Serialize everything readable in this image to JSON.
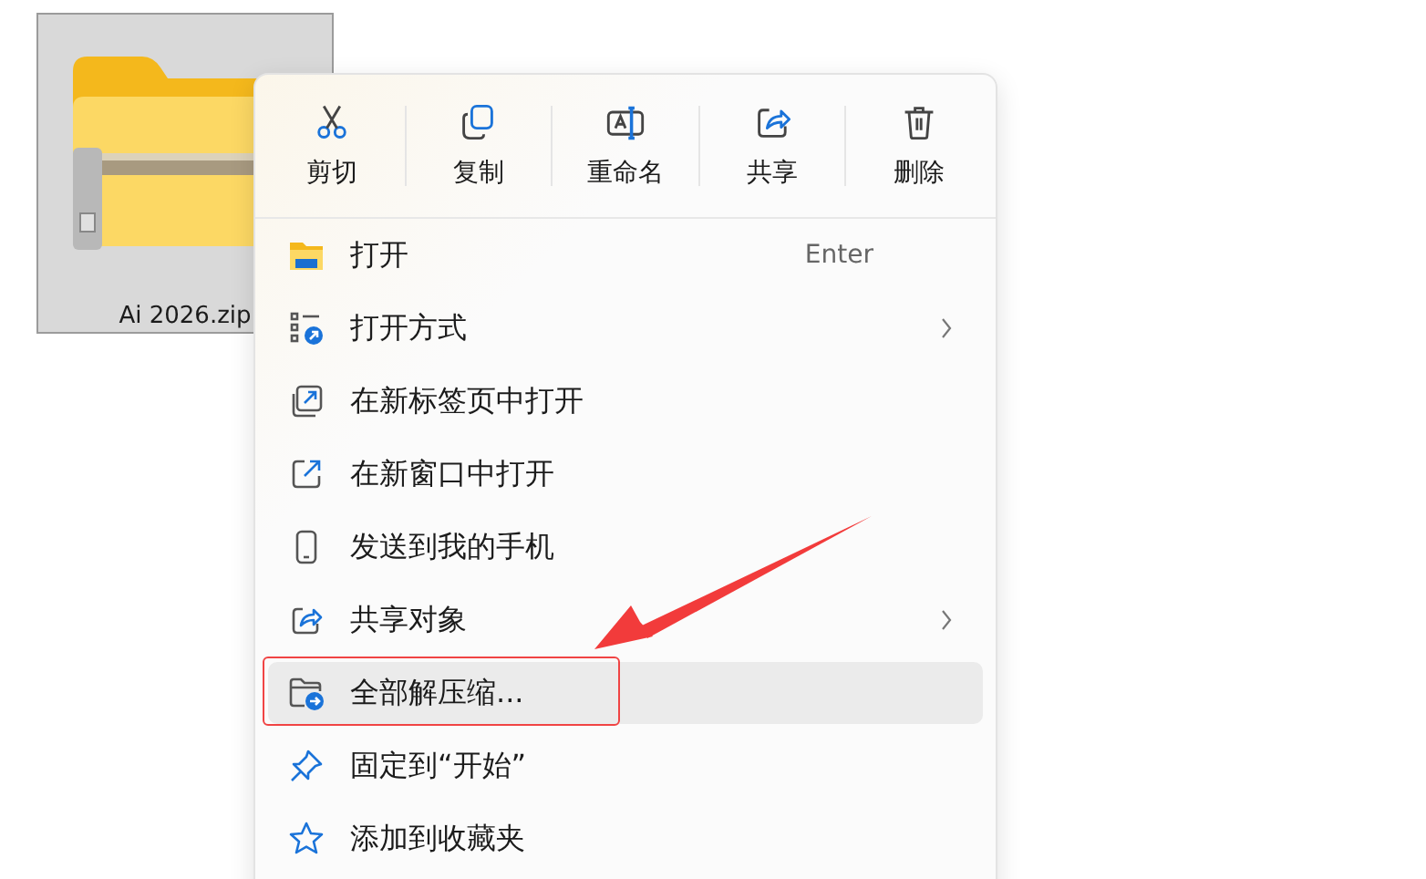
{
  "file": {
    "name": "Ai 2026.zip",
    "selected": true
  },
  "toolbar": [
    {
      "label": "剪切",
      "kind": "cut"
    },
    {
      "label": "复制",
      "kind": "copy"
    },
    {
      "label": "重命名",
      "kind": "rename"
    },
    {
      "label": "共享",
      "kind": "share"
    },
    {
      "label": "删除",
      "kind": "delete"
    }
  ],
  "items": [
    {
      "label": "打开",
      "kind": "open",
      "shortcut": "Enter",
      "submenu": false,
      "selected": false,
      "annotated": false
    },
    {
      "label": "打开方式",
      "kind": "openwith",
      "submenu": true,
      "selected": false,
      "annotated": false
    },
    {
      "label": "在新标签页中打开",
      "kind": "newtab",
      "submenu": false,
      "selected": false,
      "annotated": false
    },
    {
      "label": "在新窗口中打开",
      "kind": "newwindow",
      "submenu": false,
      "selected": false,
      "annotated": false
    },
    {
      "label": "发送到我的手机",
      "kind": "phone",
      "submenu": false,
      "selected": false,
      "annotated": false
    },
    {
      "label": "共享对象",
      "kind": "share",
      "submenu": true,
      "selected": false,
      "annotated": false
    },
    {
      "label": "全部解压缩...",
      "kind": "extract",
      "submenu": false,
      "selected": true,
      "annotated": true
    },
    {
      "label": "固定到“开始”",
      "kind": "pin",
      "submenu": false,
      "selected": false,
      "annotated": false
    },
    {
      "label": "添加到收藏夹",
      "kind": "star",
      "submenu": false,
      "selected": false,
      "annotated": false
    }
  ],
  "annotation_arrow": true
}
